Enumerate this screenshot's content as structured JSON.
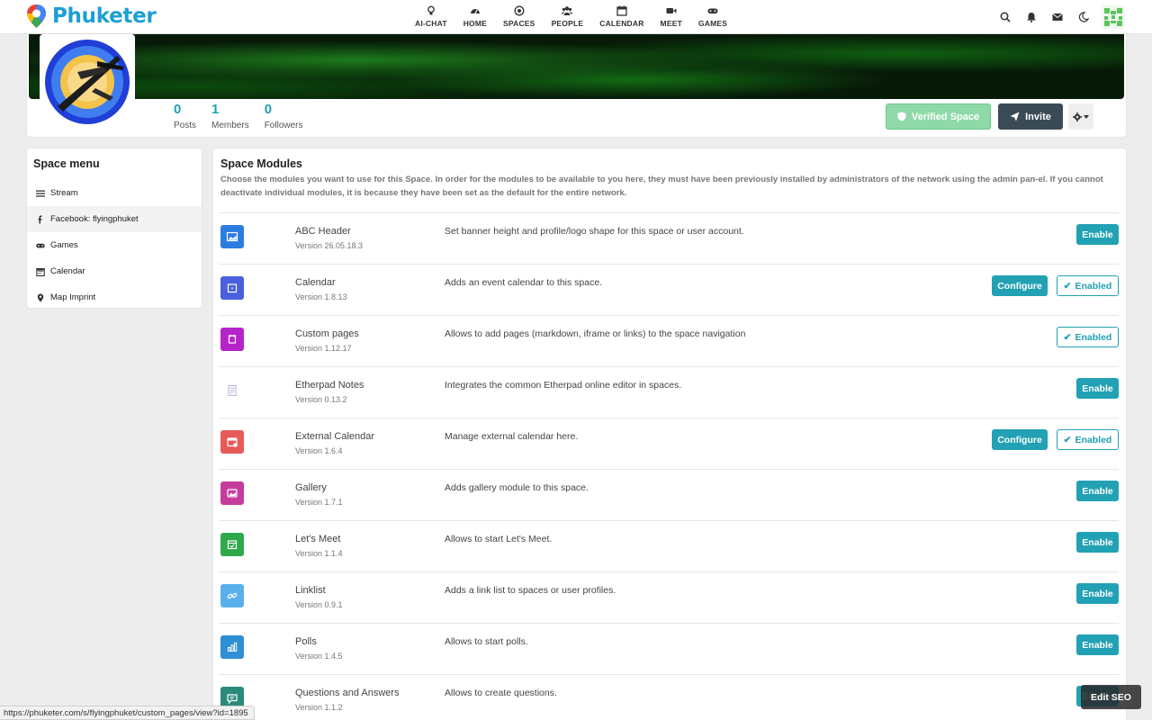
{
  "brand": {
    "name": "Phuketer"
  },
  "nav": [
    {
      "label": "AI-CHAT",
      "icon": "lightbulb-icon"
    },
    {
      "label": "HOME",
      "icon": "dashboard-icon"
    },
    {
      "label": "SPACES",
      "icon": "target-icon"
    },
    {
      "label": "PEOPLE",
      "icon": "users-icon"
    },
    {
      "label": "CALENDAR",
      "icon": "calendar-icon"
    },
    {
      "label": "MEET",
      "icon": "video-icon"
    },
    {
      "label": "GAMES",
      "icon": "gamepad-icon"
    }
  ],
  "top_icons": [
    "search-icon",
    "bell-icon",
    "envelope-icon",
    "moon-icon"
  ],
  "counters": [
    {
      "value": "0",
      "label": "Posts"
    },
    {
      "value": "1",
      "label": "Members"
    },
    {
      "value": "0",
      "label": "Followers"
    }
  ],
  "header_buttons": {
    "verified": "Verified Space",
    "invite": "Invite"
  },
  "space_menu": {
    "title": "Space menu",
    "items": [
      {
        "label": "Stream",
        "icon": "bars-icon"
      },
      {
        "label": "Facebook: flyingphuket",
        "icon": "facebook-icon"
      },
      {
        "label": "Games",
        "icon": "gamepad-icon"
      },
      {
        "label": "Calendar",
        "icon": "calendar-icon"
      },
      {
        "label": "Map Imprint",
        "icon": "map-marker-icon"
      }
    ]
  },
  "modules": {
    "title": "Space Modules",
    "description": "Choose the modules you want to use for this Space. In order for the modules to be available to you here, they must have been previously installed by administrators of the network using the admin pan-el. If you cannot deactivate individual modules, it is because they have been set as the default for the entire network.",
    "enable_label": "Enable",
    "configure_label": "Configure",
    "enabled_label": "Enabled",
    "items": [
      {
        "name": "ABC Header",
        "version": "Version 26.05.18.3",
        "description": "Set banner height and profile/logo shape for this space or user account.",
        "state": "enable",
        "color": "#2b7de0"
      },
      {
        "name": "Calendar",
        "version": "Version 1.8.13",
        "description": "Adds an event calendar to this space.",
        "state": "configure-enabled",
        "color": "#4a60e0"
      },
      {
        "name": "Custom pages",
        "version": "Version 1.12.17",
        "description": "Allows to add pages (markdown, iframe or links) to the space navigation",
        "state": "enabled",
        "color": "#b524c9"
      },
      {
        "name": "Etherpad Notes",
        "version": "Version 0.13.2",
        "description": "Integrates the common Etherpad online editor in spaces.",
        "state": "enable",
        "color": "#ffffff"
      },
      {
        "name": "External Calendar",
        "version": "Version 1.6.4",
        "description": "Manage external calendar here.",
        "state": "configure-enabled",
        "color": "#e85a5a"
      },
      {
        "name": "Gallery",
        "version": "Version 1.7.1",
        "description": "Adds gallery module to this space.",
        "state": "enable",
        "color": "#c63c9c"
      },
      {
        "name": "Let's Meet",
        "version": "Version 1.1.4",
        "description": "Allows to start Let's Meet.",
        "state": "enable",
        "color": "#2fa84a"
      },
      {
        "name": "Linklist",
        "version": "Version 0.9.1",
        "description": "Adds a link list to spaces or user profiles.",
        "state": "enable",
        "color": "#5ab0ea"
      },
      {
        "name": "Polls",
        "version": "Version 1.4.5",
        "description": "Allows to start polls.",
        "state": "enable",
        "color": "#2f8fd4"
      },
      {
        "name": "Questions and Answers",
        "version": "Version 1.1.2",
        "description": "Allows to create questions.",
        "state": "enable",
        "color": "#2c8a7a"
      }
    ]
  },
  "status_url": "https://phuketer.com/s/flyingphuket/custom_pages/view?id=1895",
  "edit_seo": "Edit SEO",
  "colors": {
    "accent": "#21a1b3",
    "brand": "#1d9fd3",
    "dark": "#3b4b56",
    "verified": "#8fd9a8"
  }
}
